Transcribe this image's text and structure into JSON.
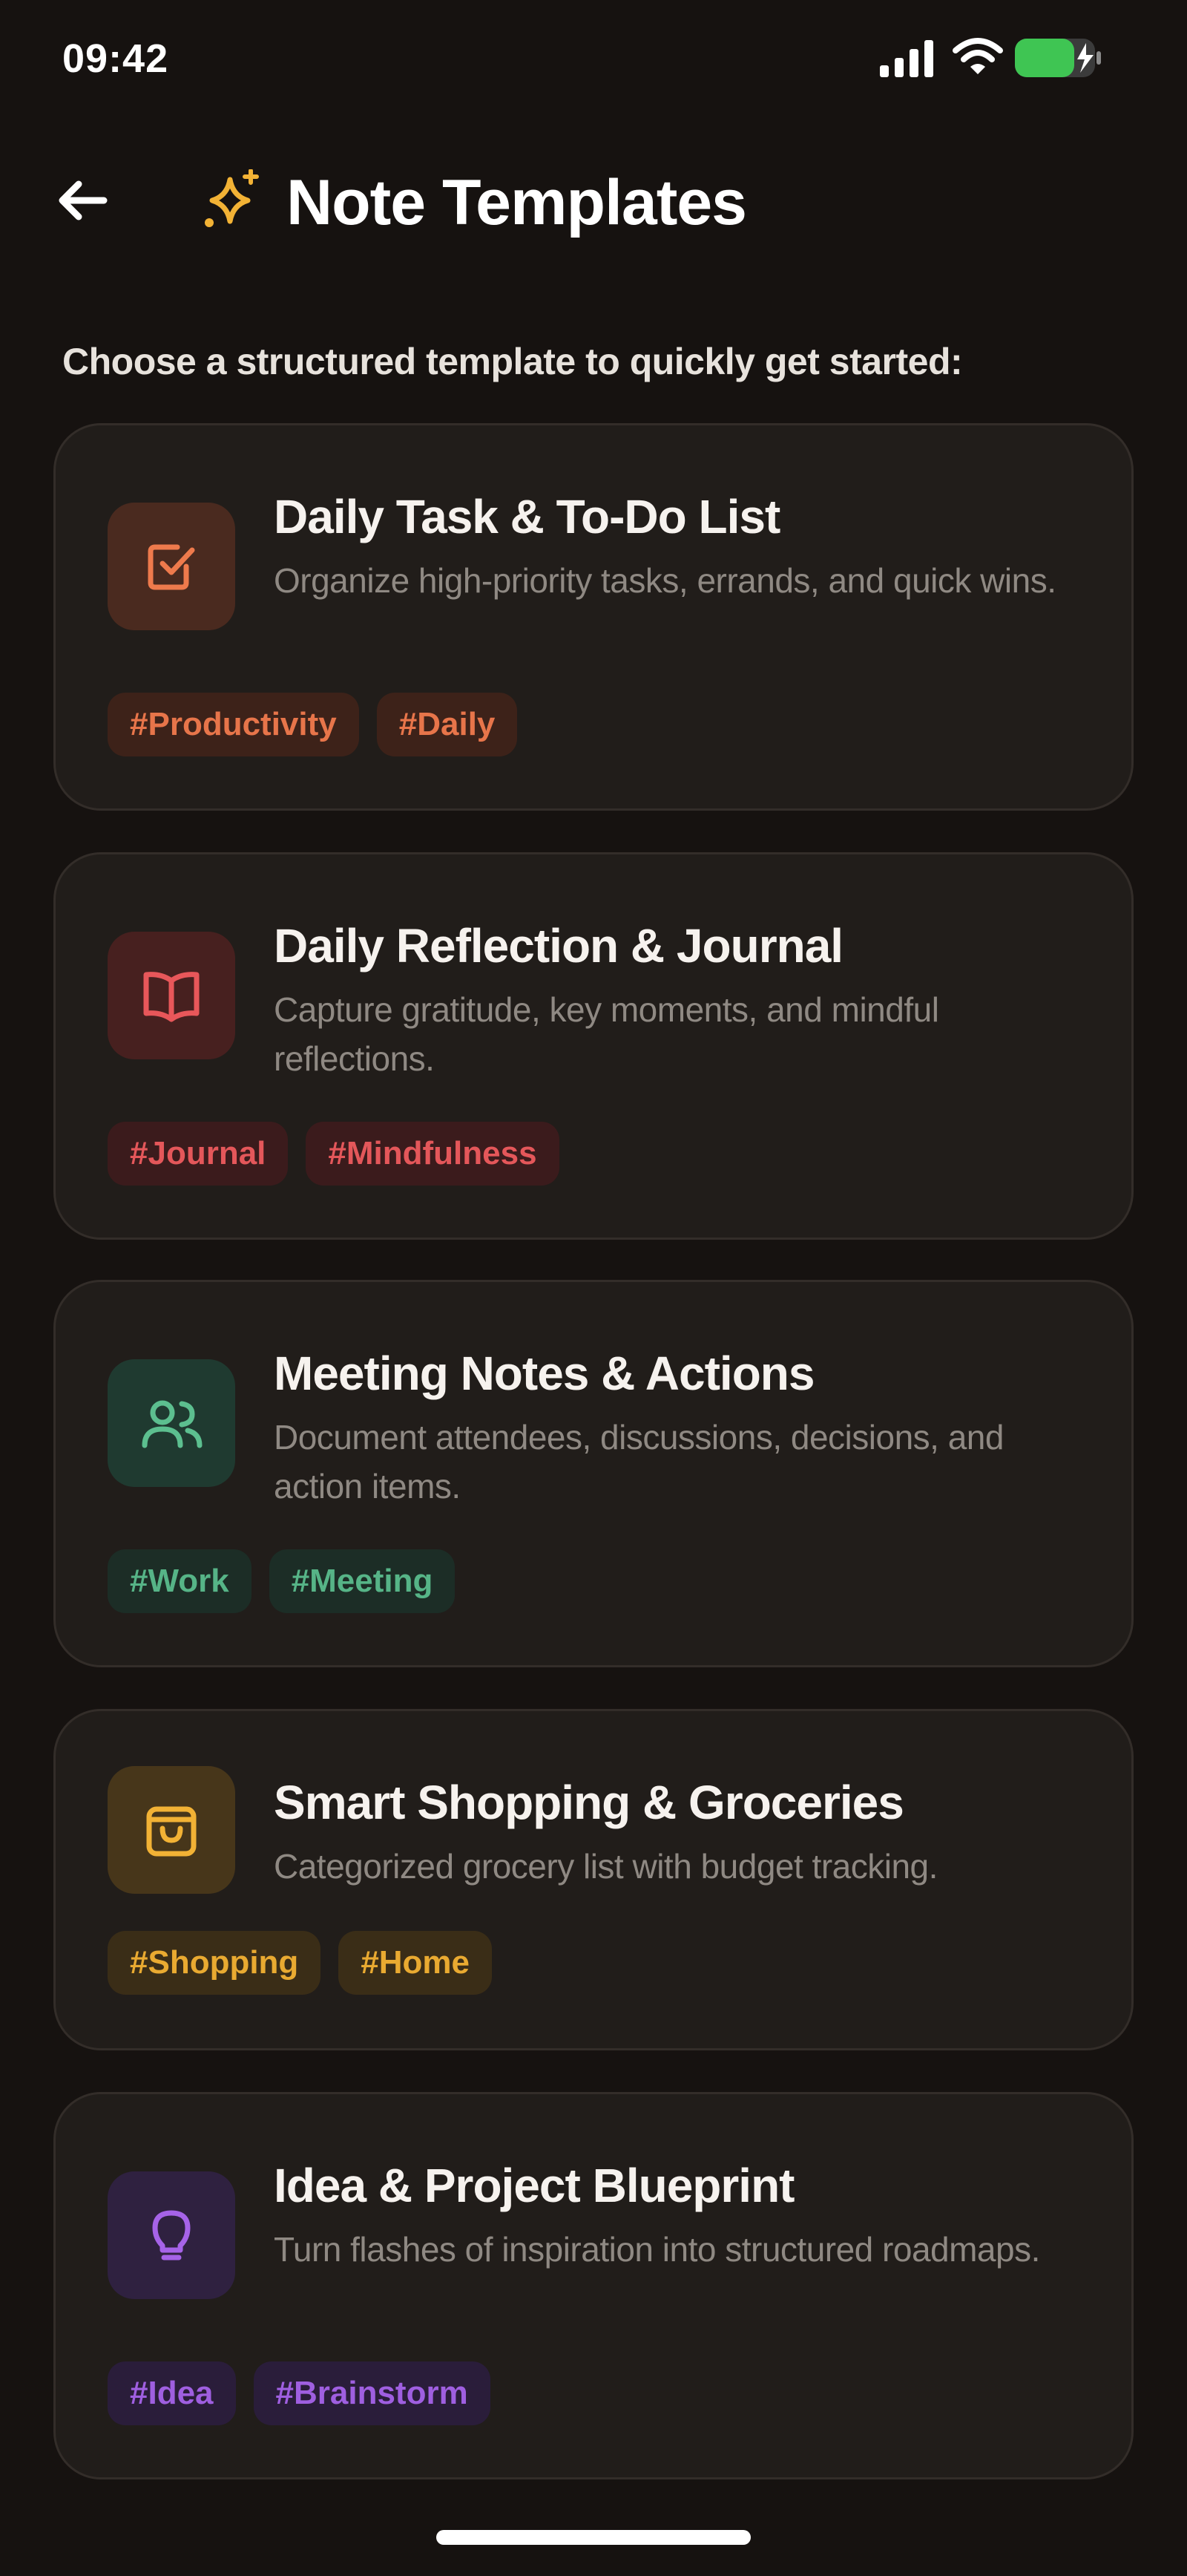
{
  "status_bar": {
    "time": "09:42"
  },
  "header": {
    "back_icon": "arrow-left-icon",
    "title_icon": "sparkles-icon",
    "title": "Note Templates"
  },
  "subtitle": "Choose a structured template to quickly get started:",
  "colors": {
    "background": "#161210",
    "card": "#211d1a",
    "accent_gold": "#f2b235",
    "tasks": "#ee7a4c",
    "journal": "#e8575a",
    "meeting": "#5cbf8f",
    "shopping": "#f2b235",
    "idea": "#a663e8"
  },
  "templates": [
    {
      "title": "Daily Task & To-Do List",
      "description": "Organize high-priority tasks, errands, and quick wins.",
      "icon": "checkbox-icon",
      "tags": [
        "#Productivity",
        "#Daily"
      ]
    },
    {
      "title": "Daily Reflection & Journal",
      "description": "Capture gratitude, key moments, and mindful reflections.",
      "icon": "book-open-icon",
      "tags": [
        "#Journal",
        "#Mindfulness"
      ]
    },
    {
      "title": "Meeting Notes & Actions",
      "description": "Document attendees, discussions, decisions, and action items.",
      "icon": "users-icon",
      "tags": [
        "#Work",
        "#Meeting"
      ]
    },
    {
      "title": "Smart Shopping & Groceries",
      "description": "Categorized grocery list with budget tracking.",
      "icon": "shopping-bag-icon",
      "tags": [
        "#Shopping",
        "#Home"
      ]
    },
    {
      "title": "Idea & Project Blueprint",
      "description": "Turn flashes of inspiration into structured roadmaps.",
      "icon": "lightbulb-icon",
      "tags": [
        "#Idea",
        "#Brainstorm"
      ]
    }
  ]
}
